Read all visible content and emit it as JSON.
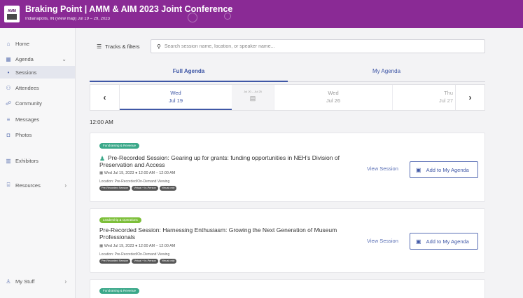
{
  "header": {
    "logo_text": "AMM",
    "title": "Braking Point | AMM & AIM 2023 Joint Conference",
    "subtitle": "Indianapolis, IN (View map)  Jul 19 – 29, 2023"
  },
  "sidebar": {
    "items": [
      {
        "label": "Home",
        "icon": "home-icon"
      },
      {
        "label": "Agenda",
        "icon": "calendar-icon"
      },
      {
        "label": "Sessions",
        "icon": "dot-icon"
      },
      {
        "label": "Attendees",
        "icon": "people-icon"
      },
      {
        "label": "Community",
        "icon": "community-icon"
      },
      {
        "label": "Messages",
        "icon": "message-icon"
      },
      {
        "label": "Photos",
        "icon": "photo-icon"
      },
      {
        "label": "Exhibitors",
        "icon": "building-icon"
      },
      {
        "label": "Resources",
        "icon": "resources-icon"
      },
      {
        "label": "My Stuff",
        "icon": "user-icon"
      }
    ]
  },
  "toolbar": {
    "tracks_label": "Tracks & filters",
    "search_placeholder": "Search session name, location, or speaker name..."
  },
  "tabs": {
    "full": "Full Agenda",
    "my": "My Agenda"
  },
  "dates": [
    {
      "weekday": "Wed",
      "date": "Jul 19"
    },
    {
      "range": "Jul 20 – Jul 25"
    },
    {
      "weekday": "Wed",
      "date": "Jul 26"
    },
    {
      "weekday": "Thu",
      "date": "Jul 27"
    }
  ],
  "time_label": "12:00 AM",
  "sessions": [
    {
      "track": "Fundraising & Revenue",
      "title": "Pre-Recorded Session: Gearing up for grants: funding opportunities in NEH's Division of Preservation and Access",
      "datetime": "Wed Jul 19, 2023",
      "time": "12:00 AM – 12:00 AM",
      "location": "Location: Pre-Recorded/On-Demand Viewing",
      "tags": [
        "Pre-Recorded Session",
        "Virtual + In-Person",
        "Virtual only"
      ],
      "view_label": "View Session",
      "add_label": "Add to My Agenda"
    },
    {
      "track": "Leadership & Operations",
      "title": "Pre-Recorded Session: Harnessing Enthusiasm: Growing the Next Generation of Museum Professionals",
      "datetime": "Wed Jul 19, 2023",
      "time": "12:00 AM – 12:00 AM",
      "location": "Location: Pre-Recorded/On-Demand Viewing",
      "tags": [
        "Pre-Recorded Session",
        "Virtual + In-Person",
        "Virtual only"
      ],
      "view_label": "View Session",
      "add_label": "Add to My Agenda"
    },
    {
      "track": "Fundraising & Revenue"
    }
  ],
  "colors": {
    "header": "#8a2a95",
    "accent": "#3f57a6",
    "track_green": "#3aa889",
    "track_lime": "#7dbf3a"
  }
}
